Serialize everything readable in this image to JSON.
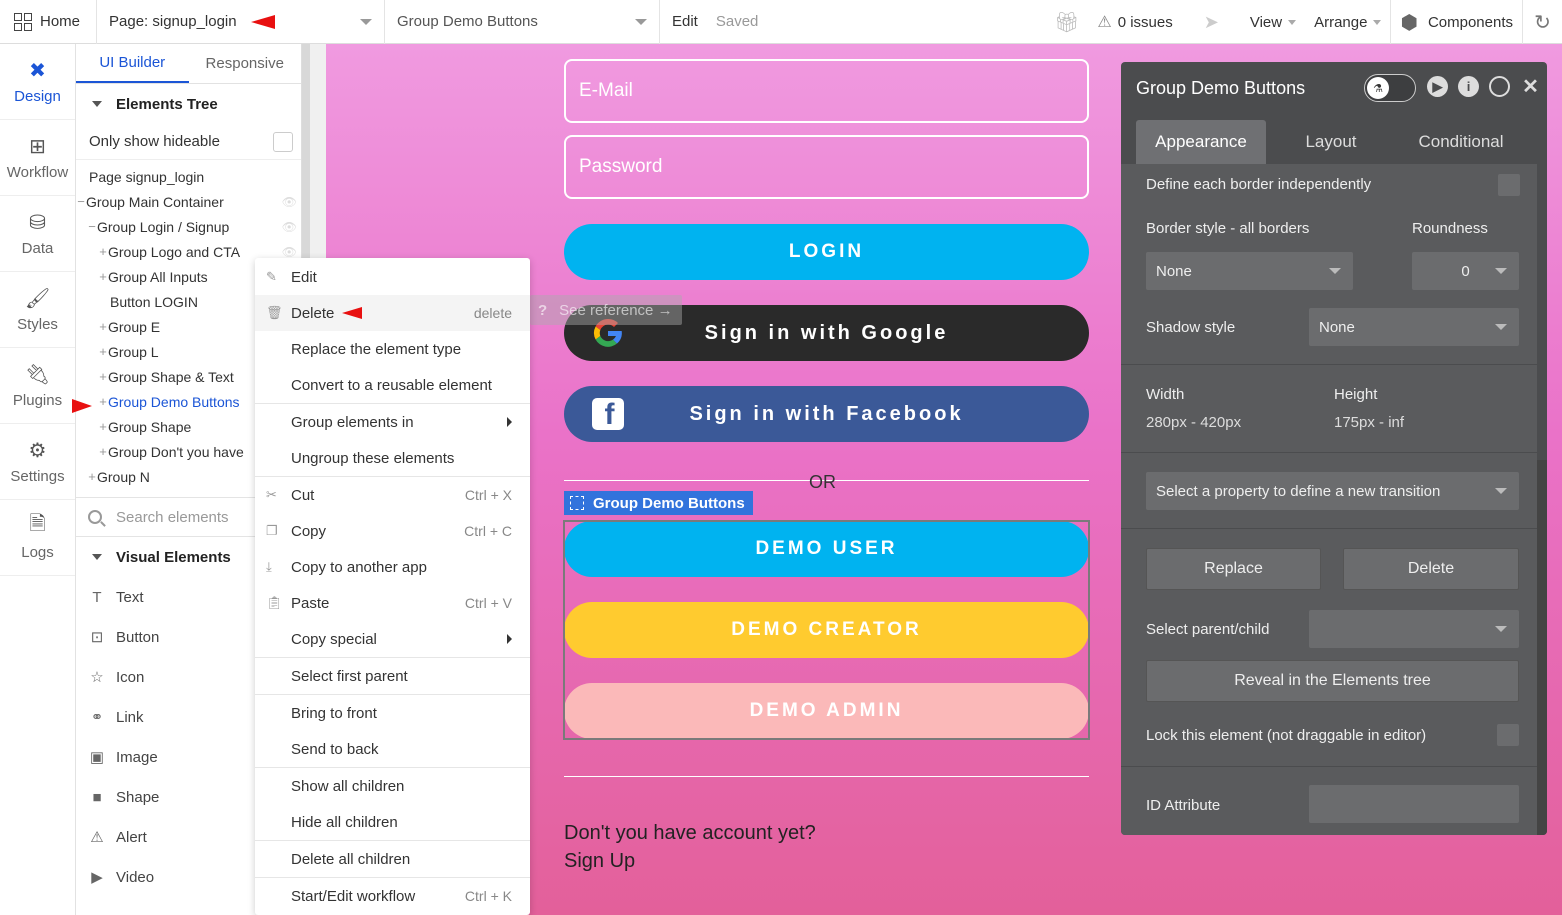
{
  "topbar": {
    "home_label": "Home",
    "page_label": "Page: signup_login",
    "group_select": "Group Demo Buttons",
    "edit_label": "Edit",
    "saved_label": "Saved",
    "issues_label": "0 issues",
    "view_label": "View",
    "arrange_label": "Arrange",
    "components_label": "Components"
  },
  "leftnav": {
    "items": [
      {
        "label": "Design"
      },
      {
        "label": "Workflow"
      },
      {
        "label": "Data"
      },
      {
        "label": "Styles"
      },
      {
        "label": "Plugins"
      },
      {
        "label": "Settings"
      },
      {
        "label": "Logs"
      }
    ]
  },
  "panel": {
    "tabs": [
      "UI Builder",
      "Responsive"
    ],
    "elements_tree_title": "Elements Tree",
    "only_hideable_label": "Only show hideable",
    "tree": [
      {
        "label": "Page signup_login",
        "prefix": ""
      },
      {
        "label": "Group Main Container",
        "prefix": "−"
      },
      {
        "label": "Group Login / Signup",
        "prefix": "−"
      },
      {
        "label": "Group Logo and CTA",
        "prefix": "+"
      },
      {
        "label": "Group All Inputs",
        "prefix": "+"
      },
      {
        "label": "Button LOGIN",
        "prefix": ""
      },
      {
        "label": "Group E",
        "prefix": "+"
      },
      {
        "label": "Group L",
        "prefix": "+"
      },
      {
        "label": "Group Shape & Text",
        "prefix": "+"
      },
      {
        "label": "Group Demo Buttons",
        "prefix": "+"
      },
      {
        "label": "Group Shape",
        "prefix": "+"
      },
      {
        "label": "Group Don't you have",
        "prefix": "+"
      },
      {
        "label": "Group N",
        "prefix": "+"
      }
    ],
    "search_placeholder": "Search elements",
    "visual_elements_title": "Visual Elements",
    "visual_elements": [
      "Text",
      "Button",
      "Icon",
      "Link",
      "Image",
      "Shape",
      "Alert",
      "Video"
    ]
  },
  "context_menu": {
    "items": [
      {
        "label": "Edit",
        "shortcut": "",
        "icon": "pencil-icon"
      },
      {
        "label": "Delete",
        "shortcut": "delete",
        "icon": "trash-icon"
      },
      {
        "label": "Replace the element type",
        "shortcut": ""
      },
      {
        "label": "Convert to a reusable element",
        "shortcut": ""
      },
      {
        "label": "Group elements in",
        "shortcut": "",
        "submenu": true
      },
      {
        "label": "Ungroup these elements",
        "shortcut": ""
      },
      {
        "label": "Cut",
        "shortcut": "Ctrl + X",
        "icon": "scissors-icon"
      },
      {
        "label": "Copy",
        "shortcut": "Ctrl + C",
        "icon": "copy-icon"
      },
      {
        "label": "Copy to another app",
        "shortcut": "",
        "icon": "download-icon"
      },
      {
        "label": "Paste",
        "shortcut": "Ctrl + V",
        "icon": "paste-icon"
      },
      {
        "label": "Copy special",
        "shortcut": "",
        "submenu": true
      },
      {
        "label": "Select first parent",
        "shortcut": ""
      },
      {
        "label": "Bring to front",
        "shortcut": ""
      },
      {
        "label": "Send to back",
        "shortcut": ""
      },
      {
        "label": "Show all children",
        "shortcut": ""
      },
      {
        "label": "Hide all children",
        "shortcut": ""
      },
      {
        "label": "Delete all children",
        "shortcut": ""
      },
      {
        "label": "Start/Edit workflow",
        "shortcut": "Ctrl + K"
      }
    ]
  },
  "canvas": {
    "email_placeholder": "E-Mail",
    "password_placeholder": "Password",
    "login_label": "LOGIN",
    "google_label": "Sign in with Google",
    "facebook_label": "Sign in with Facebook",
    "or_label": "OR",
    "group_tag_label": "Group Demo Buttons",
    "demo_user_label": "DEMO USER",
    "demo_creator_label": "DEMO CREATOR",
    "demo_admin_label": "DEMO ADMIN",
    "account_question": "Don't you have account yet?",
    "signup_link": "Sign Up",
    "see_reference": "See reference →"
  },
  "property_editor": {
    "title": "Group Demo Buttons",
    "tabs": [
      "Appearance",
      "Layout",
      "Conditional"
    ],
    "define_border_label": "Define each border independently",
    "border_style_label": "Border style - all borders",
    "roundness_label": "Roundness",
    "border_style_value": "None",
    "roundness_value": "0",
    "shadow_style_label": "Shadow style",
    "shadow_style_value": "None",
    "width_label": "Width",
    "width_value": "280px - 420px",
    "height_label": "Height",
    "height_value": "175px - inf",
    "transition_placeholder": "Select a property to define a new transition",
    "replace_label": "Replace",
    "delete_label": "Delete",
    "select_parent_label": "Select parent/child",
    "reveal_label": "Reveal in the Elements tree",
    "lock_label": "Lock this element (not draggable in editor)",
    "id_attribute_label": "ID Attribute"
  },
  "colors": {
    "accent_blue": "#1b55d6",
    "login_button": "#00b3f0",
    "google_button": "#2a2a2a",
    "facebook_button": "#3b5998",
    "demo_creator": "#ffcb2f",
    "demo_admin": "#fbb9b9",
    "annotation_red": "#e81010",
    "editor_bg": "#4b4c4e"
  }
}
